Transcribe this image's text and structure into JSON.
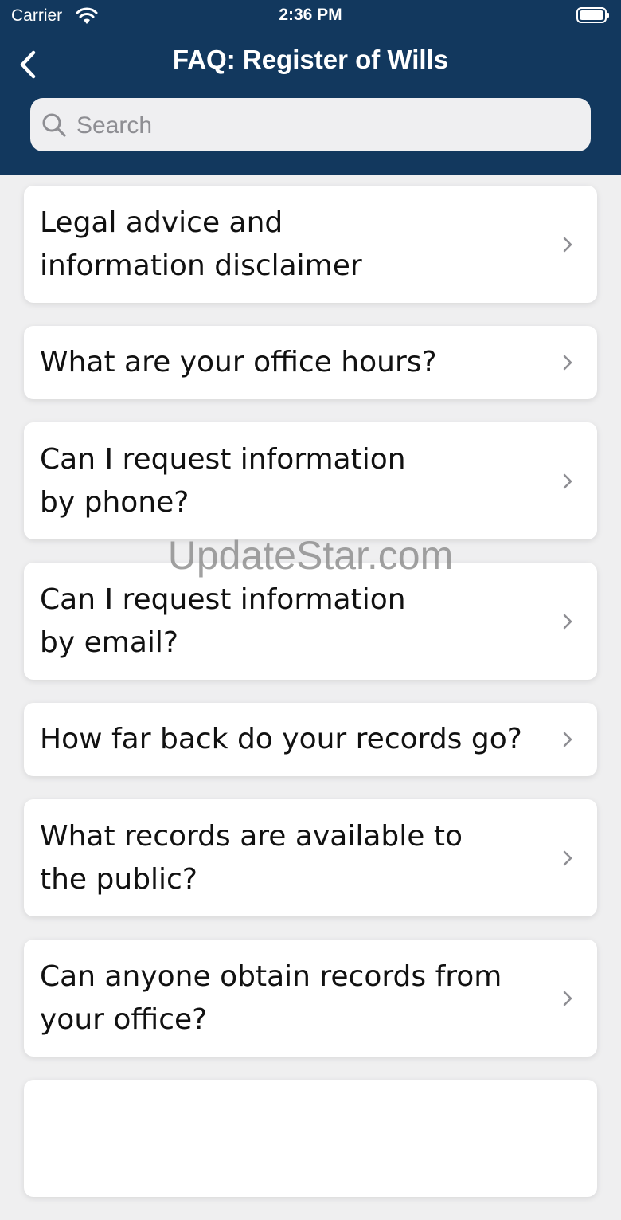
{
  "status_bar": {
    "carrier": "Carrier",
    "time": "2:36 PM"
  },
  "header": {
    "title": "FAQ: Register of Wills"
  },
  "search": {
    "placeholder": "Search",
    "value": ""
  },
  "faq_items": [
    {
      "label": "Legal advice and\ninformation disclaimer"
    },
    {
      "label": "What are your office hours?"
    },
    {
      "label": "Can I request information\nby phone?"
    },
    {
      "label": "Can I request information\nby email?"
    },
    {
      "label": "How far back do your records go?"
    },
    {
      "label": "What records are available to\nthe public?"
    },
    {
      "label": "Can anyone obtain records from\nyour office?"
    }
  ],
  "watermark": "UpdateStar.com"
}
